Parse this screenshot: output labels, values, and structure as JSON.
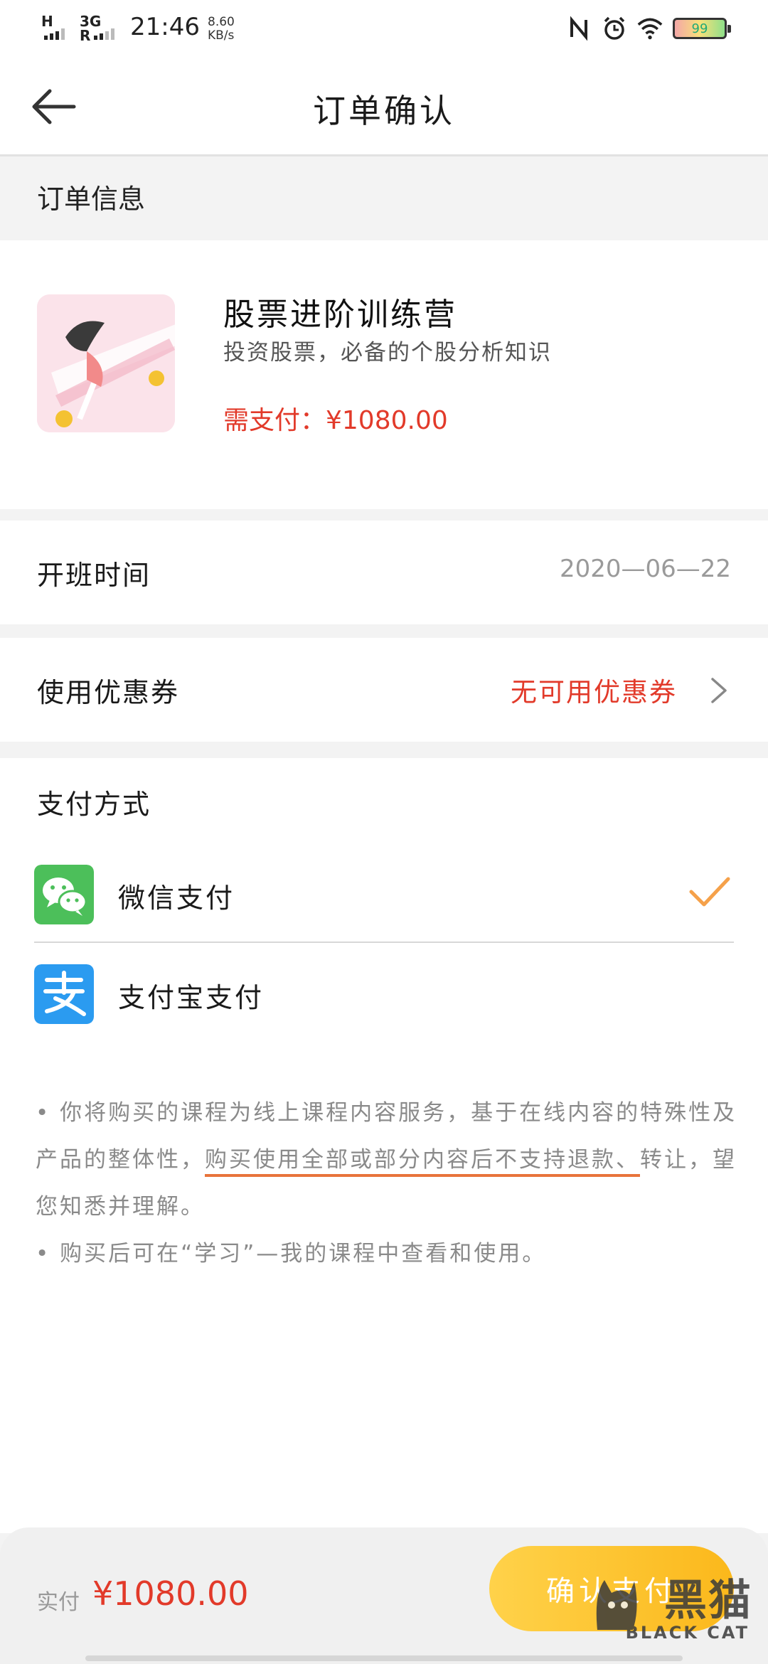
{
  "status_bar": {
    "network_top": "H",
    "network_bottom": "3G",
    "network_r": "R",
    "time": "21:46",
    "speed_value": "8.60",
    "speed_unit": "KB/s",
    "battery": "99"
  },
  "nav": {
    "title": "订单确认"
  },
  "order_info": {
    "section_title": "订单信息",
    "product_title": "股票进阶训练营",
    "product_desc": "投资股票，必备的个股分析知识",
    "price_text": "需支付：¥1080.00"
  },
  "class_time": {
    "label": "开班时间",
    "value": "2020—06—22"
  },
  "coupon": {
    "label": "使用优惠券",
    "value": "无可用优惠券"
  },
  "payment": {
    "title": "支付方式",
    "methods": [
      {
        "label": "微信支付",
        "icon": "wechat-pay-icon",
        "selected": true
      },
      {
        "label": "支付宝支付",
        "icon": "alipay-icon",
        "selected": false
      }
    ],
    "notice_1_prefix": "• 你将购买的课程为线上课程内容服务，基于在线内容的特殊性及产品的整体性，",
    "notice_1_highlight": "购买使用全部或部分内容后不支持退款、",
    "notice_1_suffix": "转让，望您知悉并理解。",
    "notice_2": "• 购买后可在“学习”—我的课程中查看和使用。"
  },
  "bottom_bar": {
    "paid_label": "实付",
    "paid_amount": "¥1080.00",
    "confirm_label": "确认支付"
  },
  "watermark": {
    "cn": "黑猫",
    "en": "BLACK CAT"
  },
  "colors": {
    "accent_red": "#e23a2a",
    "button_yellow": "#fbb81b",
    "check_orange": "#f5a14a",
    "wechat_green": "#4cbf5a",
    "alipay_blue": "#2b9bf0"
  }
}
